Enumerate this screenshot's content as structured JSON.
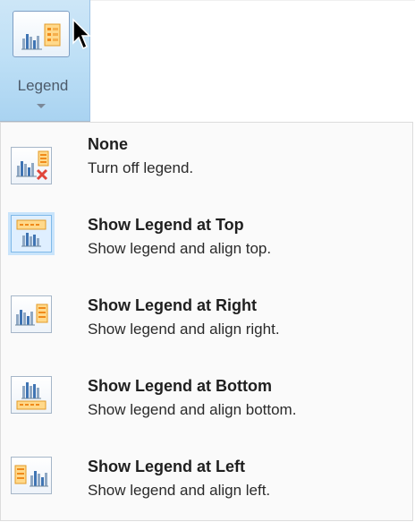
{
  "ribbon": {
    "legend_label": "Legend"
  },
  "menu": {
    "items": [
      {
        "title": "None",
        "description": "Turn off legend.",
        "icon": "legend-none-icon",
        "selected": false
      },
      {
        "title": "Show Legend at Top",
        "description": "Show legend and align top.",
        "icon": "legend-top-icon",
        "selected": true
      },
      {
        "title": "Show Legend at Right",
        "description": "Show legend and align right.",
        "icon": "legend-right-icon",
        "selected": false
      },
      {
        "title": "Show Legend at Bottom",
        "description": "Show legend and align bottom.",
        "icon": "legend-bottom-icon",
        "selected": false
      },
      {
        "title": "Show Legend at Left",
        "description": "Show legend and align left.",
        "icon": "legend-left-icon",
        "selected": false
      }
    ]
  },
  "colors": {
    "ribbon_highlight": "#bfe0f6",
    "legend_orange": "#f2a33a",
    "bar_blue": "#3f74b3",
    "remove_red": "#e0453a"
  }
}
